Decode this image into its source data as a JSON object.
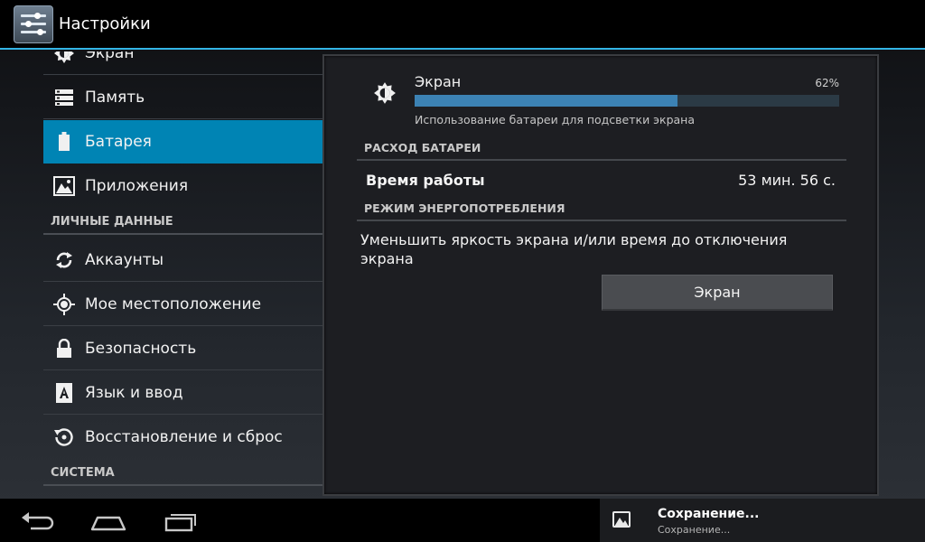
{
  "action_bar": {
    "title": "Настройки",
    "icon": "settings-sliders-icon"
  },
  "sidebar": {
    "items": [
      {
        "label": "Экран",
        "icon": "brightness-icon"
      },
      {
        "label": "Память",
        "icon": "storage-icon"
      },
      {
        "label": "Батарея",
        "icon": "battery-icon",
        "selected": true
      },
      {
        "label": "Приложения",
        "icon": "apps-icon"
      },
      {
        "label": "Аккаунты",
        "icon": "sync-icon"
      },
      {
        "label": "Мое местоположение",
        "icon": "location-icon"
      },
      {
        "label": "Безопасность",
        "icon": "lock-icon"
      },
      {
        "label": "Язык и ввод",
        "icon": "language-icon"
      },
      {
        "label": "Восстановление и сброс",
        "icon": "restore-icon"
      }
    ],
    "sections": {
      "personal": "ЛИЧНЫЕ ДАННЫЕ",
      "system": "СИСТЕМА"
    },
    "selected_color": "#0084b4"
  },
  "detail": {
    "usage": {
      "title": "Экран",
      "percent_label": "62%",
      "percent": 62,
      "description": "Использование батареи для подсветки экрана",
      "icon": "brightness-icon"
    },
    "battery_usage_header": "РАСХОД БАТАРЕИ",
    "runtime": {
      "label": "Время работы",
      "value": "53 мин. 56 с."
    },
    "power_mode_header": "РЕЖИМ ЭНЕРГОПОТРЕБЛЕНИЯ",
    "tip": "Уменьшить яркость экрана и/или время до отключения экрана",
    "screen_button": "Экран",
    "bar_color": "#3c82b4"
  },
  "notification": {
    "title": "Сохранение...",
    "subtitle": "Сохранение...",
    "icon": "image-icon"
  },
  "navigation": {
    "back": "back-icon",
    "home": "home-icon",
    "recents": "recents-icon"
  },
  "accent_color": "#33b5e5"
}
